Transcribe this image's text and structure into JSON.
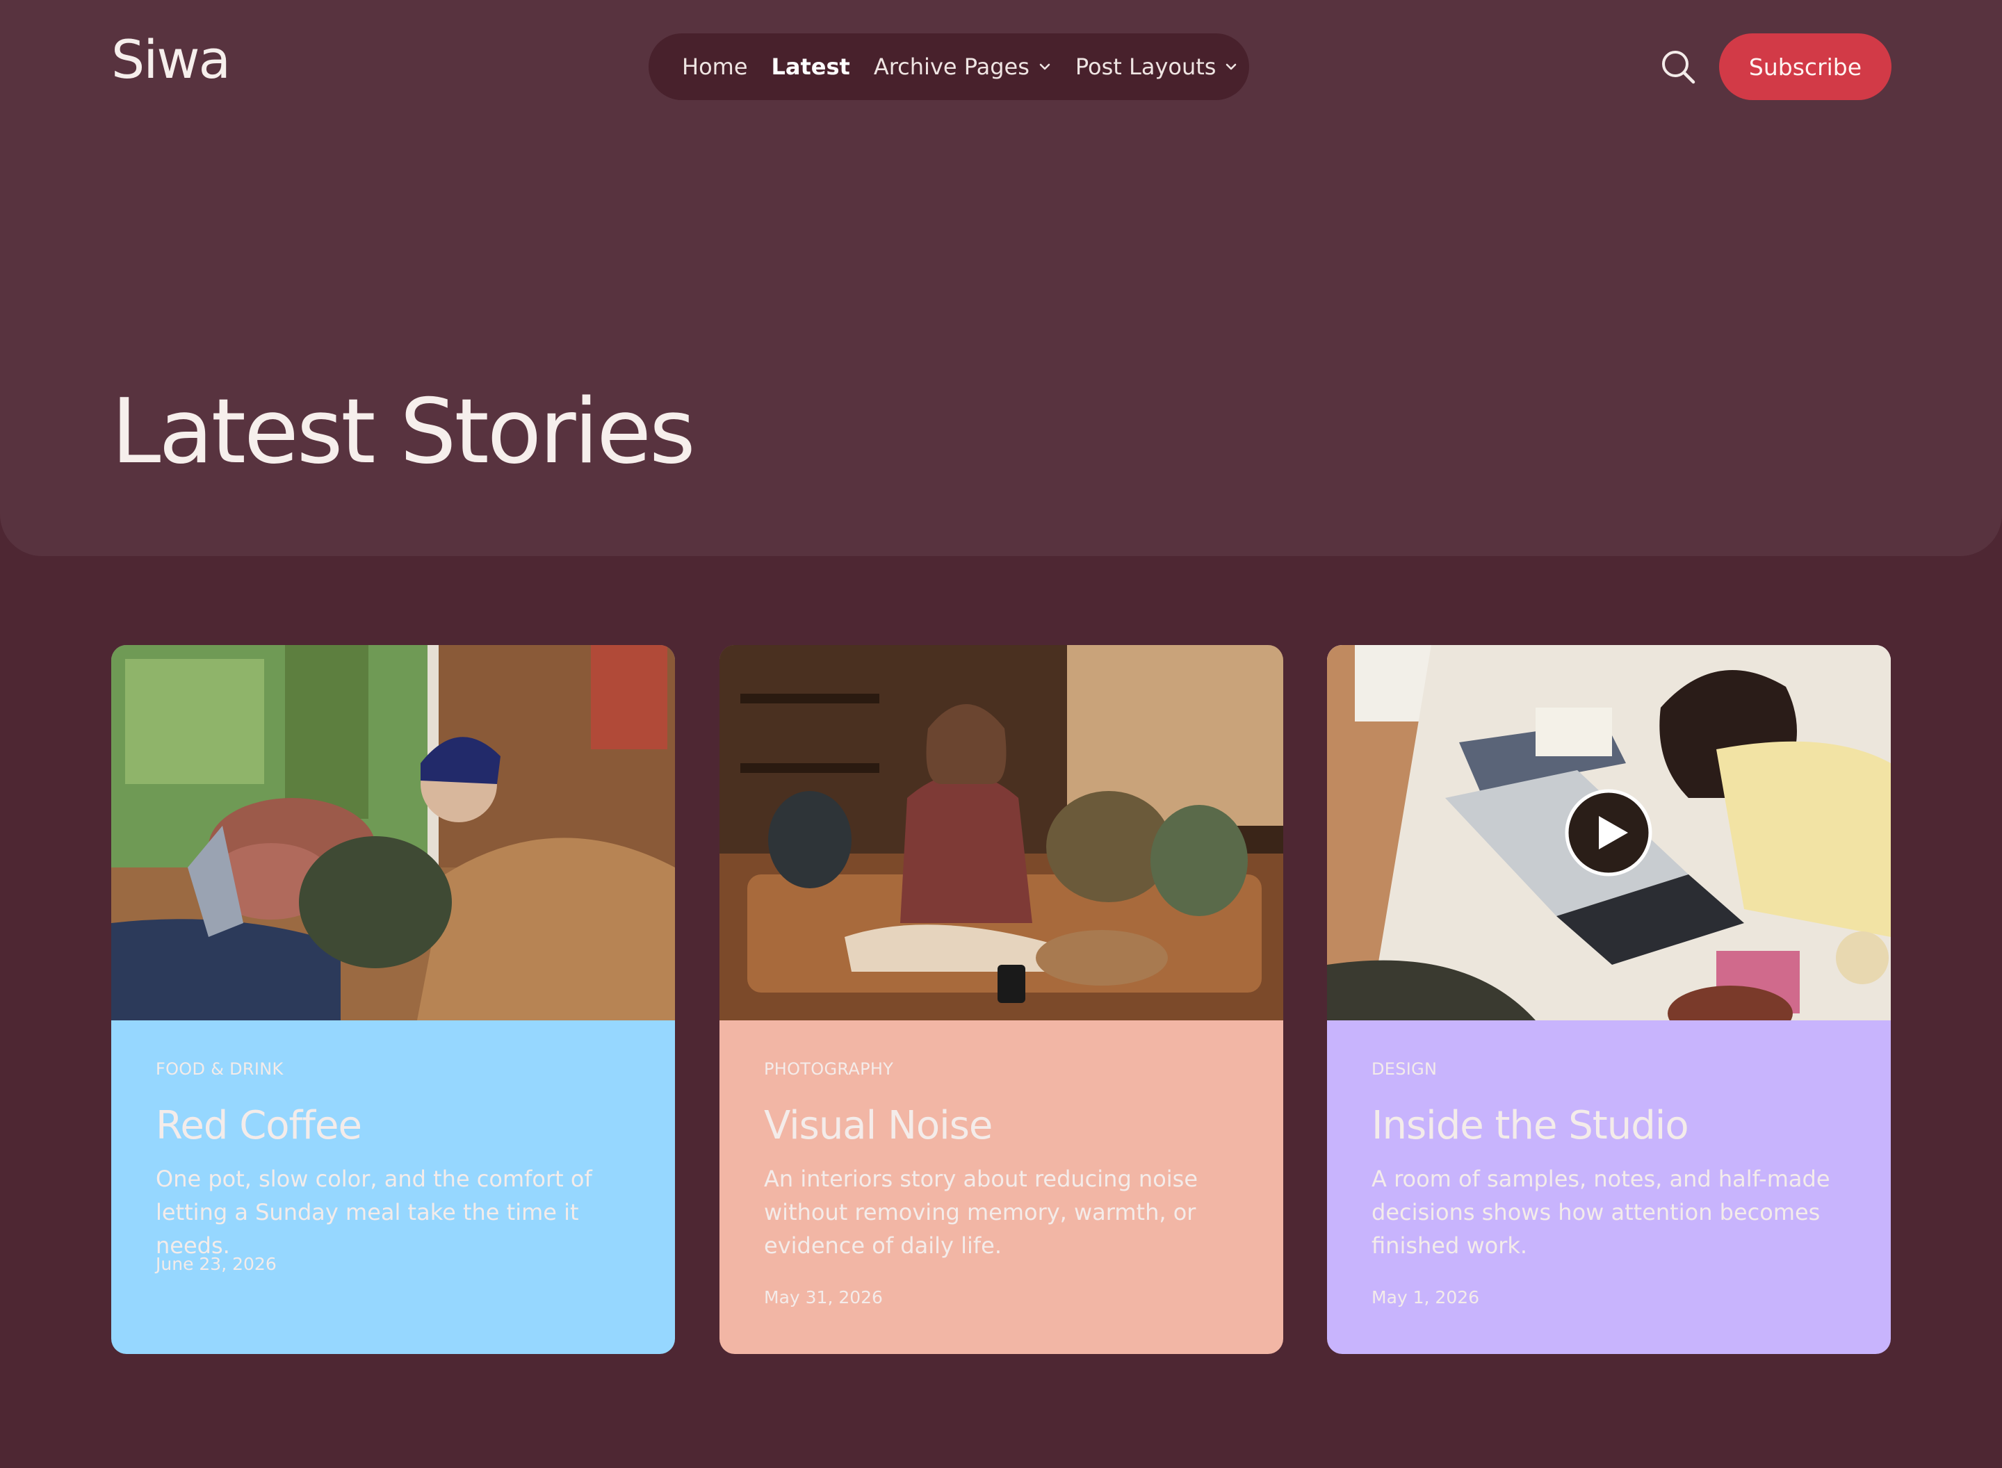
{
  "header": {
    "site_title": "Siwa",
    "nav": [
      {
        "label": "Home",
        "active": false,
        "has_dropdown": false
      },
      {
        "label": "Latest",
        "active": true,
        "has_dropdown": false
      },
      {
        "label": "Archive Pages",
        "active": false,
        "has_dropdown": true
      },
      {
        "label": "Post Layouts",
        "active": false,
        "has_dropdown": true
      }
    ],
    "search_icon": "search-icon",
    "subscribe_label": "Subscribe"
  },
  "hero": {
    "heading": "Latest Stories"
  },
  "posts": [
    {
      "category": "FOOD & DRINK",
      "title": "Red Coffee",
      "excerpt": "One pot, slow color, and the comfort of letting a Sunday meal take the time it needs.",
      "date": "June 23, 2026",
      "card_color": "#96d7ff",
      "has_video": false
    },
    {
      "category": "PHOTOGRAPHY",
      "title": "Visual Noise",
      "excerpt": "An interiors story about reducing noise without removing memory, warmth, or evidence of daily life.",
      "date": "May 31, 2026",
      "card_color": "#f2b6a5",
      "has_video": false
    },
    {
      "category": "DESIGN",
      "title": "Inside the Studio",
      "excerpt": "A room of samples, notes, and half-made decisions shows how attention becomes finished work.",
      "date": "May 1, 2026",
      "card_color": "#c8b4fd",
      "has_video": true
    }
  ],
  "colors": {
    "page_bg": "#4e2733",
    "hero_bg": "#58333f",
    "nav_bg": "#48212c",
    "accent": "#d23a47"
  }
}
